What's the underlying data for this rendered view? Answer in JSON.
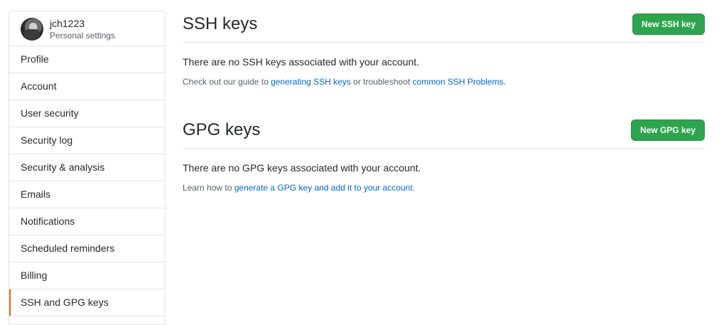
{
  "sidebar": {
    "username": "jch1223",
    "subtitle": "Personal settings",
    "items": [
      {
        "label": "Profile"
      },
      {
        "label": "Account"
      },
      {
        "label": "User security"
      },
      {
        "label": "Security log"
      },
      {
        "label": "Security & analysis"
      },
      {
        "label": "Emails"
      },
      {
        "label": "Notifications"
      },
      {
        "label": "Scheduled reminders"
      },
      {
        "label": "Billing"
      },
      {
        "label": "SSH and GPG keys"
      }
    ],
    "active_index": 9
  },
  "ssh": {
    "title": "SSH keys",
    "button": "New SSH key",
    "message": "There are no SSH keys associated with your account.",
    "hint_prefix": "Check out our guide to ",
    "hint_link1": "generating SSH keys",
    "hint_middle": " or troubleshoot ",
    "hint_link2": "common SSH Problems",
    "hint_suffix": "."
  },
  "gpg": {
    "title": "GPG keys",
    "button": "New GPG key",
    "message": "There are no GPG keys associated with your account.",
    "hint_prefix": "Learn how to ",
    "hint_link": "generate a GPG key and add it to your account",
    "hint_suffix": "."
  },
  "colors": {
    "accent_active": "#e36209",
    "button_green": "#2ea44f",
    "link": "#0366d6"
  }
}
